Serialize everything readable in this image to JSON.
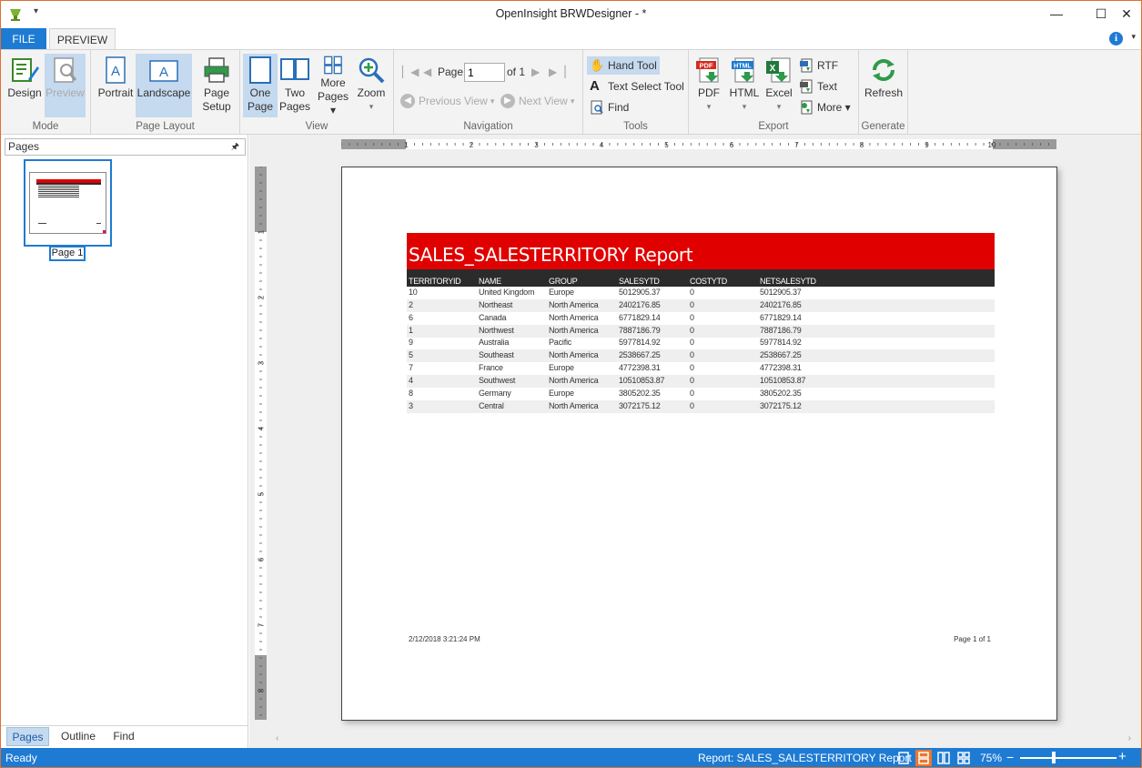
{
  "window": {
    "title": "OpenInsight BRWDesigner -  *",
    "minimize": "—",
    "maximize": "☐",
    "close": "✕",
    "qat_caret": "▾"
  },
  "tabs": {
    "file": "FILE",
    "preview": "PREVIEW"
  },
  "ribbon": {
    "mode": {
      "label": "Mode",
      "design": "Design",
      "preview": "Preview"
    },
    "page_layout": {
      "label": "Page Layout",
      "portrait": "Portrait",
      "landscape": "Landscape",
      "page_setup_1": "Page",
      "page_setup_2": "Setup"
    },
    "view": {
      "label": "View",
      "one_page_1": "One",
      "one_page_2": "Page",
      "two_pages_1": "Two",
      "two_pages_2": "Pages",
      "more_pages_1": "More",
      "more_pages_2": "Pages ▾",
      "zoom": "Zoom",
      "zoom_caret": "▾"
    },
    "navigation": {
      "label": "Navigation",
      "page_label": "Page",
      "page_value": "1",
      "of_label": "of 1",
      "previous_view": "Previous View",
      "next_view": "Next View"
    },
    "tools": {
      "label": "Tools",
      "hand_tool": "Hand Tool",
      "text_select_tool": "Text Select Tool",
      "find": "Find"
    },
    "export": {
      "label": "Export",
      "pdf": "PDF",
      "html": "HTML",
      "excel": "Excel",
      "rtf": "RTF",
      "text": "Text",
      "more": "More ▾",
      "caret": "▾"
    },
    "generate": {
      "label": "Generate",
      "refresh": "Refresh"
    }
  },
  "left_pane": {
    "header": "Pages",
    "thumb_label": "Page 1",
    "bottom_tabs": [
      "Pages",
      "Outline",
      "Find"
    ]
  },
  "ruler": {
    "h_numbers": [
      "1",
      "2",
      "3",
      "4",
      "5",
      "6",
      "7",
      "8",
      "9",
      "10"
    ],
    "v_numbers": [
      "1",
      "2",
      "3",
      "4",
      "5",
      "6",
      "7",
      "8"
    ]
  },
  "report": {
    "title": "SALES_SALESTERRITORY Report",
    "columns": [
      "TERRITORYID",
      "NAME",
      "GROUP",
      "SALESYTD",
      "COSTYTD",
      "NETSALESYTD"
    ],
    "rows": [
      [
        "10",
        "United Kingdom",
        "Europe",
        "5012905.37",
        "0",
        "5012905.37"
      ],
      [
        "2",
        "Northeast",
        "North America",
        "2402176.85",
        "0",
        "2402176.85"
      ],
      [
        "6",
        "Canada",
        "North America",
        "6771829.14",
        "0",
        "6771829.14"
      ],
      [
        "1",
        "Northwest",
        "North America",
        "7887186.79",
        "0",
        "7887186.79"
      ],
      [
        "9",
        "Australia",
        "Pacific",
        "5977814.92",
        "0",
        "5977814.92"
      ],
      [
        "5",
        "Southeast",
        "North America",
        "2538667.25",
        "0",
        "2538667.25"
      ],
      [
        "7",
        "France",
        "Europe",
        "4772398.31",
        "0",
        "4772398.31"
      ],
      [
        "4",
        "Southwest",
        "North America",
        "10510853.87",
        "0",
        "10510853.87"
      ],
      [
        "8",
        "Germany",
        "Europe",
        "3805202.35",
        "0",
        "3805202.35"
      ],
      [
        "3",
        "Central",
        "North America",
        "3072175.12",
        "0",
        "3072175.12"
      ]
    ],
    "footer_date": "2/12/2018 3:21:24 PM",
    "footer_page": "Page 1 of 1"
  },
  "status": {
    "ready": "Ready",
    "report": "Report: SALES_SALESTERRITORY Report",
    "zoom": "75%",
    "zoom_minus": "−",
    "zoom_plus": "+"
  },
  "colors": {
    "accent": "#1e7bd3",
    "banner": "#e00000",
    "header": "#2b2b2b",
    "selected": "#c5d9ef",
    "orange": "#e87830"
  }
}
